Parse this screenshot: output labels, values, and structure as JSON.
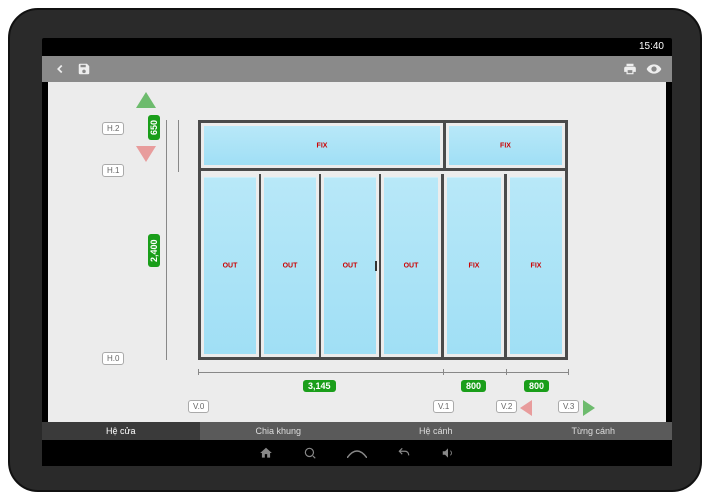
{
  "statusbar": {
    "time": "15:40"
  },
  "toolbar": {
    "back_icon": "back",
    "save_icon": "save",
    "print_icon": "print",
    "eye_icon": "eye"
  },
  "tabs": {
    "items": [
      "Hệ cửa",
      "Chia khung",
      "Hệ cánh",
      "Từng cánh"
    ],
    "active_index": 0
  },
  "markers": {
    "h0": "H.0",
    "h1": "H.1",
    "h2": "H.2",
    "v0": "V.0",
    "v1": "V.1",
    "v2": "V.2",
    "v3": "V.3"
  },
  "dimensions": {
    "total_height": "2,400",
    "top_height": "650",
    "span1_width": "3,145",
    "span2_width": "800",
    "span3_width": "800"
  },
  "panel_labels": {
    "fix": "FIX",
    "out": "OUT"
  },
  "layout": {
    "transom_panels": [
      "FIX",
      "FIX"
    ],
    "lower_panels": [
      "OUT",
      "OUT",
      "OUT",
      "OUT",
      "FIX",
      "FIX"
    ]
  },
  "colors": {
    "accent_green": "#1a9e1a",
    "frame": "#4a4a4a",
    "glass": "#a8e3f7"
  }
}
